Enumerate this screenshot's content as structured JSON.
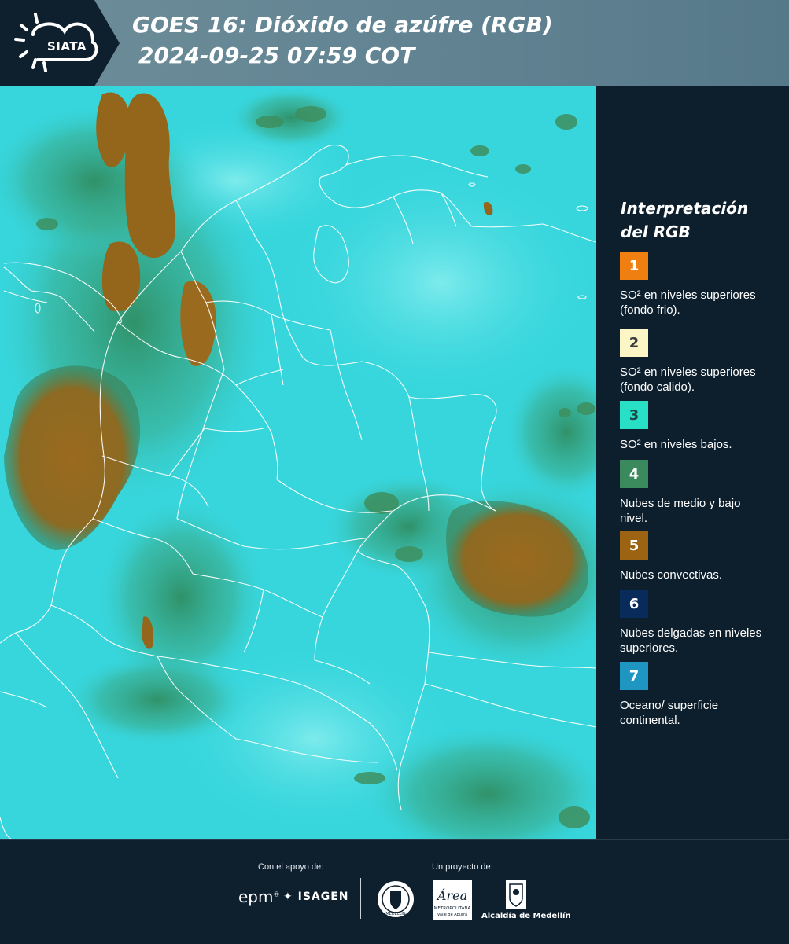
{
  "header": {
    "logo_text": "SIATA",
    "title_line1": "GOES 16: Dióxido de azúfre (RGB)",
    "title_line2": "2024-09-25 07:59 COT"
  },
  "legend": {
    "title": "Interpretación del RGB",
    "items": [
      {
        "number": "1",
        "color": "#f07f12",
        "text_color": "#ffffff",
        "label": "SO² en niveles superiores (fondo frio)."
      },
      {
        "number": "2",
        "color": "#fcf5c5",
        "text_color": "#3a3a3a",
        "label": "SO² en niveles superiores (fondo calido)."
      },
      {
        "number": "3",
        "color": "#27e0c6",
        "text_color": "#1d4a4a",
        "label": "SO² en niveles bajos."
      },
      {
        "number": "4",
        "color": "#3b8a5e",
        "text_color": "#ffffff",
        "label": "Nubes de medio y bajo nivel."
      },
      {
        "number": "5",
        "color": "#9b6312",
        "text_color": "#ffffff",
        "label": "Nubes convectivas."
      },
      {
        "number": "6",
        "color": "#082b5c",
        "text_color": "#ffffff",
        "label": "Nubes delgadas en niveles superiores."
      },
      {
        "number": "7",
        "color": "#1f96c2",
        "text_color": "#ffffff",
        "label": "Oceano/ superficie continental."
      }
    ]
  },
  "footer": {
    "support_label": "Con el apoyo de:",
    "project_label": "Un proyecto de:",
    "sponsor_epm": "epm",
    "sponsor_isagen": "ISAGEN",
    "partner_medellin_seal": "MEDELLÍN",
    "partner_area": "Área",
    "partner_area_sub": "METROPOLITANA",
    "partner_area_sub2": "Valle de Aburrá",
    "partner_alcaldia": "Alcaldía de Medellín"
  },
  "colors": {
    "background": "#0e1f2e",
    "header_band": "#5f8190",
    "map_base": "#37d6dd",
    "convective_cloud": "#9b6a1f",
    "low_cloud": "#3b8a5e"
  }
}
